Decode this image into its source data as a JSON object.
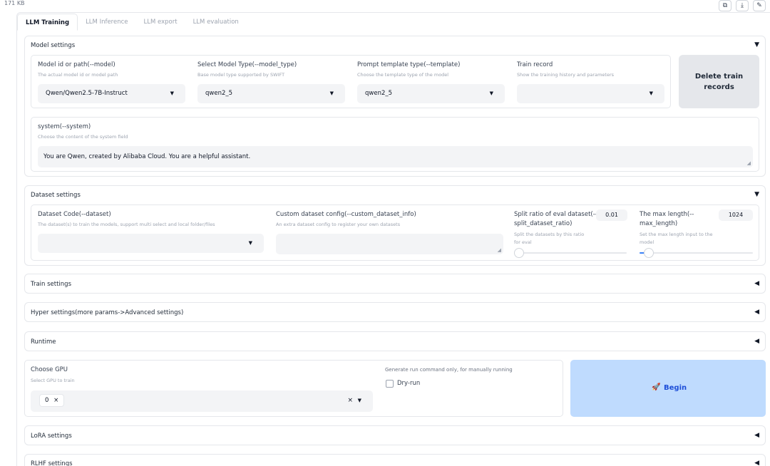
{
  "topbar": {
    "file_size": "171 KB"
  },
  "tabs": [
    "LLM Training",
    "LLM Inference",
    "LLM export",
    "LLM evaluation"
  ],
  "model_settings": {
    "title": "Model settings",
    "model": {
      "label": "Model id or path(--model)",
      "hint": "The actual model id or model path",
      "value": "Qwen/Qwen2.5-7B-Instruct"
    },
    "model_type": {
      "label": "Select Model Type(--model_type)",
      "hint": "Base model type supported by SWIFT",
      "value": "qwen2_5"
    },
    "template": {
      "label": "Prompt template type(--template)",
      "hint": "Choose the template type of the model",
      "value": "qwen2_5"
    },
    "train_record": {
      "label": "Train record",
      "hint": "Show the training history and parameters",
      "value": ""
    },
    "delete_button": "Delete train records",
    "system": {
      "label": "system(--system)",
      "hint": "Choose the content of the system field",
      "value": "You are Qwen, created by Alibaba Cloud. You are a helpful assistant."
    }
  },
  "dataset_settings": {
    "title": "Dataset settings",
    "dataset": {
      "label": "Dataset Code(--dataset)",
      "hint": "The dataset(s) to train the models, support multi select and local folder/files",
      "value": ""
    },
    "custom_info": {
      "label": "Custom dataset config(--custom_dataset_info)",
      "hint": "An extra dataset config to register your own datasets",
      "value": ""
    },
    "split_ratio": {
      "label": "Split ratio of eval dataset(--split_dataset_ratio)",
      "label_line1": "Split ratio of eval dataset(--",
      "label_line2": "split_dataset_ratio)",
      "hint_line1": "Split the datasets by this ratio",
      "hint_line2": "for eval",
      "value": "0.01",
      "level": 0.01
    },
    "max_length": {
      "label": "The max length(--max_length)",
      "label_line1": "The max length(--",
      "label_line2": "max_length)",
      "hint_line1": "Set the max length input to the",
      "hint_line2": "model",
      "value": "1024",
      "level": 0.06
    }
  },
  "collapsed_sections": {
    "train": "Train settings",
    "hyper": "Hyper settings(more params->Advanced settings)",
    "runtime": "Runtime",
    "lora": "LoRA settings",
    "rlhf": "RLHF settings"
  },
  "gpu": {
    "label": "Choose GPU",
    "hint": "Select GPU to train",
    "selected": [
      "0"
    ],
    "clear_symbol": "×"
  },
  "dry_run": {
    "hint": "Generate run command only, for manually running",
    "label": "Dry-run",
    "checked": false
  },
  "begin_button": {
    "emoji": "🚀",
    "label": "Begin"
  },
  "icons": {
    "expanded": "▼",
    "collapsed": "◀",
    "caret": "▼"
  },
  "colors": {
    "accent": "#3b82f6",
    "begin_bg": "#bfdbfe",
    "begin_text": "#1d4ed8"
  }
}
